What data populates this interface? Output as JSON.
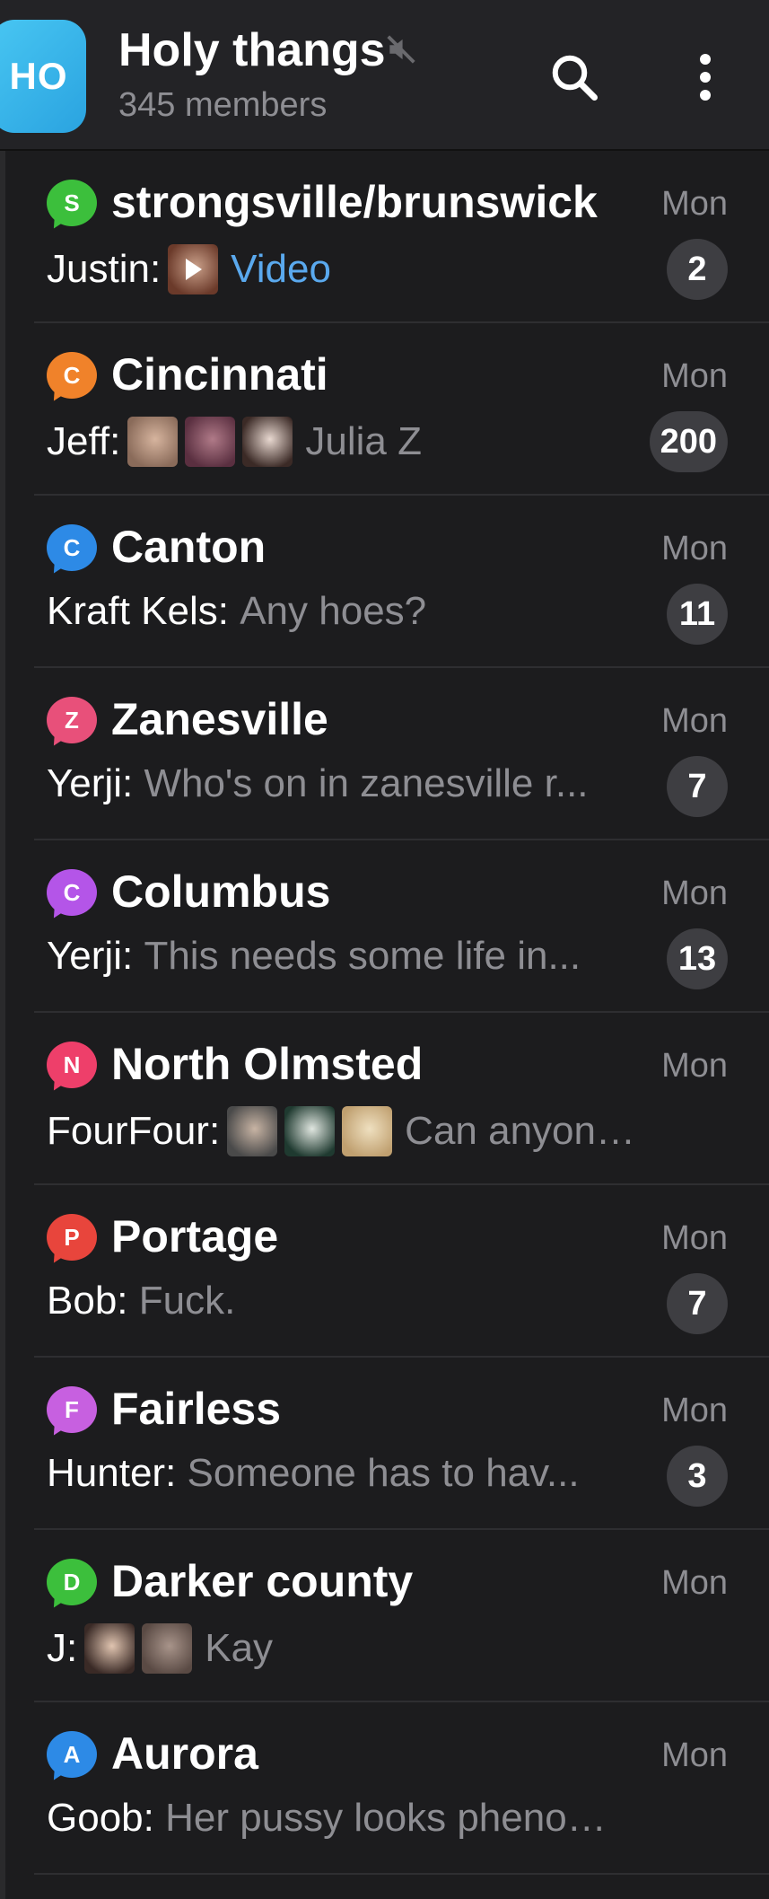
{
  "header": {
    "avatar_text": "HO",
    "title": "Holy thangs",
    "members": "345 members"
  },
  "chats": [
    {
      "title": "strongsville/brunswick",
      "letter": "S",
      "color": "#3cbf3c",
      "time": "Mon",
      "sender": "Justin:",
      "message": "Video",
      "message_style": "link",
      "thumbs": [
        {
          "c1": "#6b3a2a",
          "c2": "#caa08a",
          "play": true
        }
      ],
      "badge": "2"
    },
    {
      "title": "Cincinnati",
      "letter": "C",
      "color": "#f0822a",
      "time": "Mon",
      "sender": "Jeff:",
      "message": "Julia Z",
      "message_style": "muted",
      "thumbs": [
        {
          "c1": "#8a6b5a",
          "c2": "#d6b49e"
        },
        {
          "c1": "#5a2f40",
          "c2": "#b07a88"
        },
        {
          "c1": "#3b2a26",
          "c2": "#e8d8d0"
        }
      ],
      "badge": "200"
    },
    {
      "title": "Canton",
      "letter": "C",
      "color": "#2d8ae6",
      "time": "Mon",
      "sender": "Kraft Kels:",
      "message": "Any hoes?",
      "message_style": "muted",
      "thumbs": [],
      "badge": "11"
    },
    {
      "title": "Zanesville",
      "letter": "Z",
      "color": "#e8507a",
      "time": "Mon",
      "sender": "Yerji:",
      "message": "Who's on in zanesville r...",
      "message_style": "muted",
      "thumbs": [],
      "badge": "7"
    },
    {
      "title": "Columbus",
      "letter": "C",
      "color": "#b455e8",
      "time": "Mon",
      "sender": "Yerji:",
      "message": "This needs some life in...",
      "message_style": "muted",
      "thumbs": [],
      "badge": "13"
    },
    {
      "title": "North Olmsted",
      "letter": "N",
      "color": "#ee3f6a",
      "time": "Mon",
      "sender": "FourFour:",
      "message": "Can anyone c...",
      "message_style": "muted",
      "thumbs": [
        {
          "c1": "#4a4a4a",
          "c2": "#c8b4a4"
        },
        {
          "c1": "#1f3a30",
          "c2": "#e0e6e0"
        },
        {
          "c1": "#c0a070",
          "c2": "#efe0c0"
        }
      ],
      "badge": ""
    },
    {
      "title": "Portage",
      "letter": "P",
      "color": "#e8453c",
      "time": "Mon",
      "sender": "Bob:",
      "message": "Fuck.",
      "message_style": "muted",
      "thumbs": [],
      "badge": "7"
    },
    {
      "title": "Fairless",
      "letter": "F",
      "color": "#c760e0",
      "time": "Mon",
      "sender": "Hunter:",
      "message": "Someone has to hav...",
      "message_style": "muted",
      "thumbs": [],
      "badge": "3"
    },
    {
      "title": "Darker county",
      "letter": "D",
      "color": "#3cbf3c",
      "time": "Mon",
      "sender": "J:",
      "message": "Kay",
      "message_style": "muted",
      "thumbs": [
        {
          "c1": "#3a2a26",
          "c2": "#e0c4b0"
        },
        {
          "c1": "#5a4a44",
          "c2": "#a8948a"
        }
      ],
      "badge": ""
    },
    {
      "title": "Aurora",
      "letter": "A",
      "color": "#2d8ae6",
      "time": "Mon",
      "sender": "Goob:",
      "message": "Her pussy looks phenome...",
      "message_style": "muted",
      "thumbs": [],
      "badge": ""
    }
  ]
}
